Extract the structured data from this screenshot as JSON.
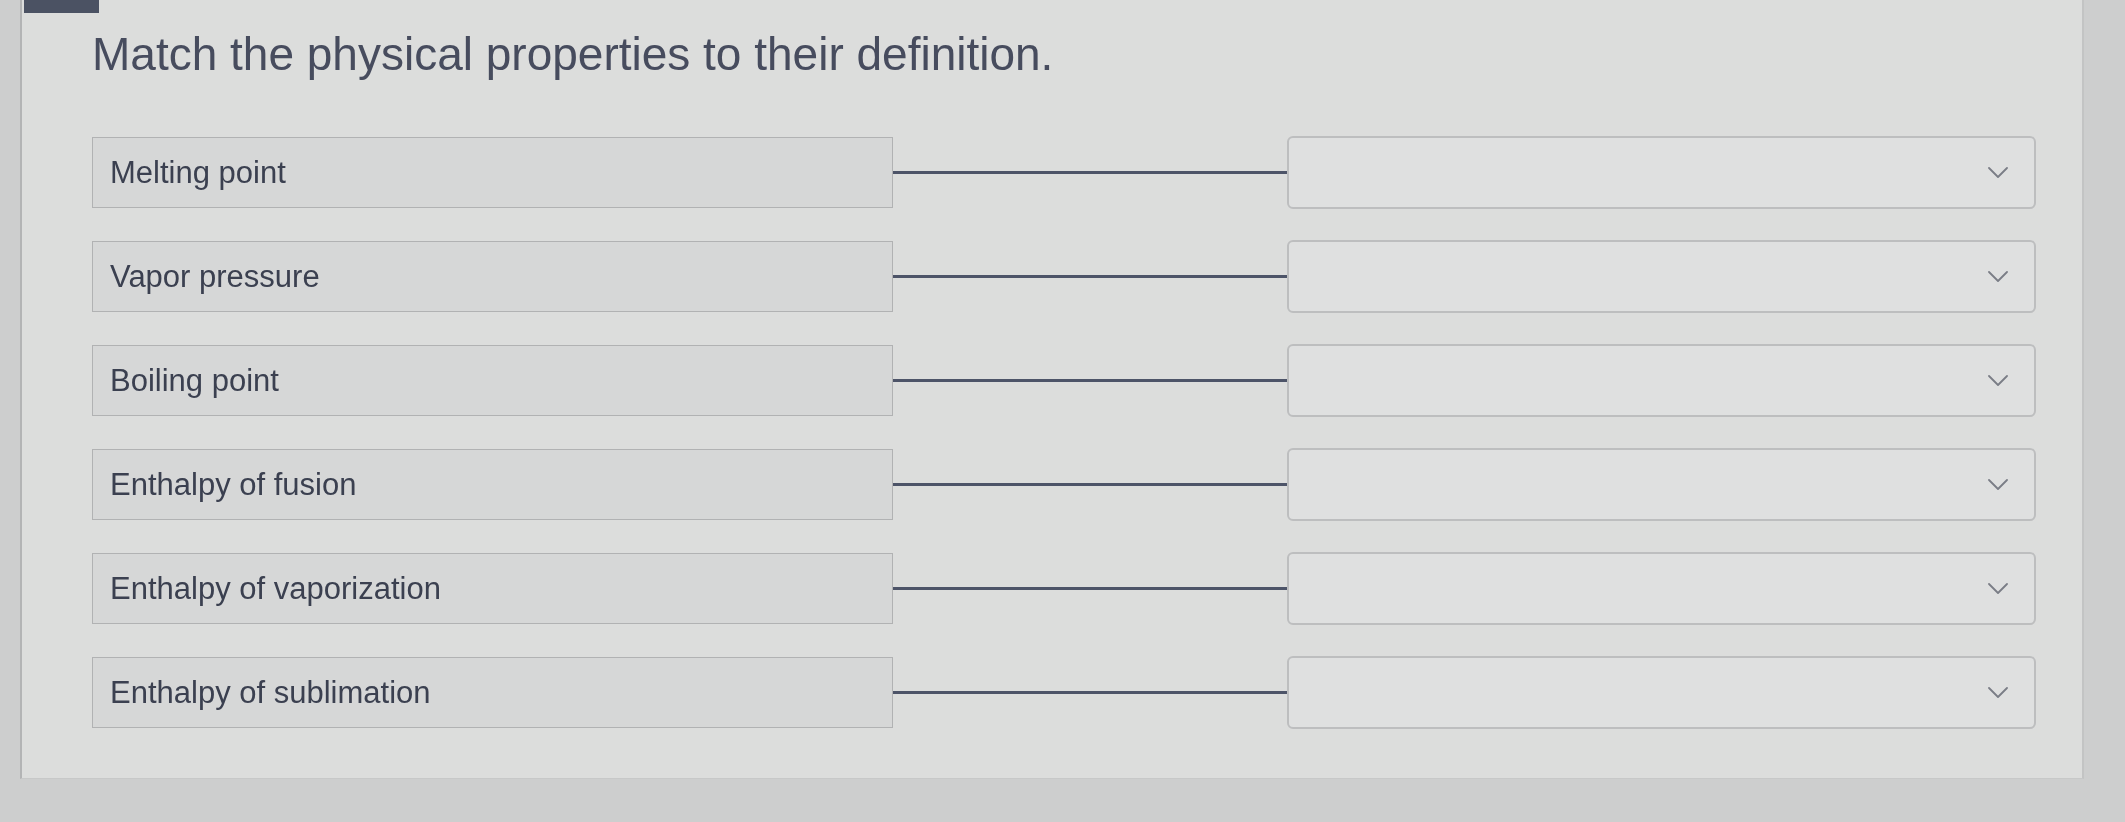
{
  "header": {
    "title": "Match the physical properties to their definition."
  },
  "pairs": [
    {
      "term": "Melting point"
    },
    {
      "term": "Vapor pressure"
    },
    {
      "term": "Boiling point"
    },
    {
      "term": "Enthalpy of fusion"
    },
    {
      "term": "Enthalpy of vaporization"
    },
    {
      "term": "Enthalpy of sublimation"
    }
  ]
}
